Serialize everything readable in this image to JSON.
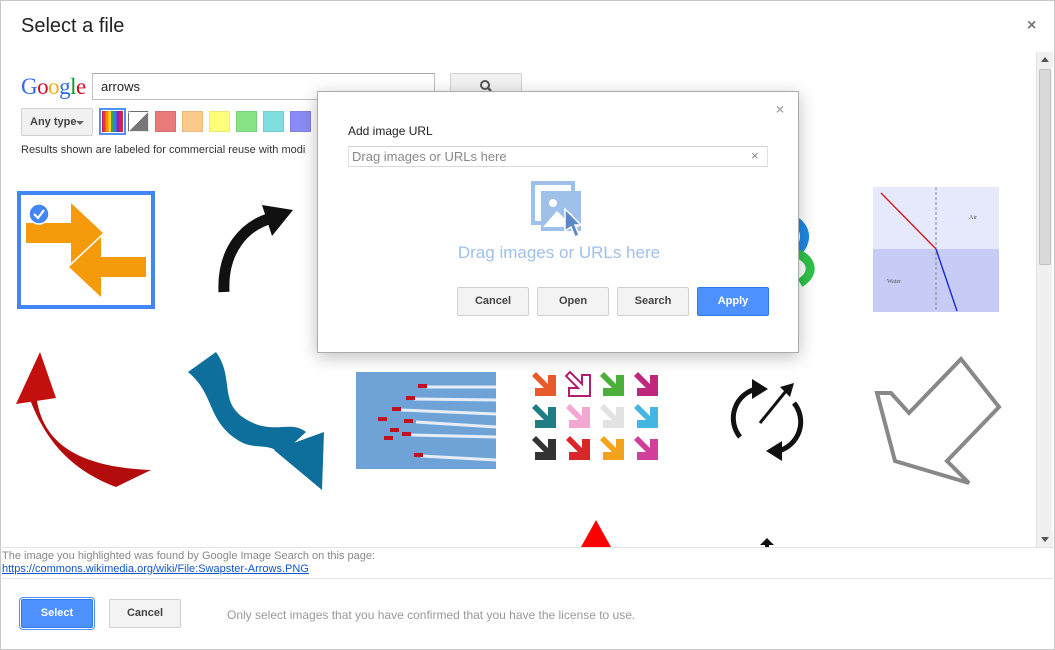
{
  "dialog_title": "Select a file",
  "close_glyph": "×",
  "google_logo": [
    "G",
    "o",
    "o",
    "g",
    "l",
    "e"
  ],
  "google_logo_colors": [
    "#3369e8",
    "#d50f25",
    "#eeb211",
    "#3369e8",
    "#009925",
    "#d50f25"
  ],
  "search": {
    "value": "arrows",
    "button_icon": "magnifier-icon"
  },
  "filters": {
    "type_label": "Any type",
    "color_swatches": [
      "multicolor",
      "black-and-white",
      "#e87a7a",
      "#fcc98a",
      "#ffff7a",
      "#86e386",
      "#7fdfdf",
      "#8a8cf5"
    ],
    "results_note": "Results shown are labeled for commercial reuse with modi"
  },
  "results": [
    {
      "name": "swapster-arrows",
      "selected": true
    },
    {
      "name": "black-curved-arrow"
    },
    {
      "name": "blue-green-ribbon-arrow"
    },
    {
      "name": "refraction-diagram",
      "labels": [
        "Air",
        "Water"
      ]
    },
    {
      "name": "red-curved-arrow"
    },
    {
      "name": "blue-wavy-arrow"
    },
    {
      "name": "red-arrows-jets"
    },
    {
      "name": "colored-arrow-grid"
    },
    {
      "name": "circular-arrows"
    },
    {
      "name": "gray-outline-arrow"
    },
    {
      "name": "red-triangle"
    },
    {
      "name": "small-black-arrow"
    }
  ],
  "info": {
    "text": "The image you highlighted was found by Google Image Search on this page:",
    "link": "https://commons.wikimedia.org/wiki/File:Swapster-Arrows.PNG"
  },
  "footer": {
    "select_label": "Select",
    "cancel_label": "Cancel",
    "note": "Only select images that you have confirmed that you have the license to use."
  },
  "url_dialog": {
    "label": "Add image URL",
    "placeholder": "Drag images or URLs here",
    "drag_text": "Drag images or URLs here",
    "buttons": {
      "cancel": "Cancel",
      "open": "Open",
      "search": "Search",
      "apply": "Apply"
    }
  }
}
